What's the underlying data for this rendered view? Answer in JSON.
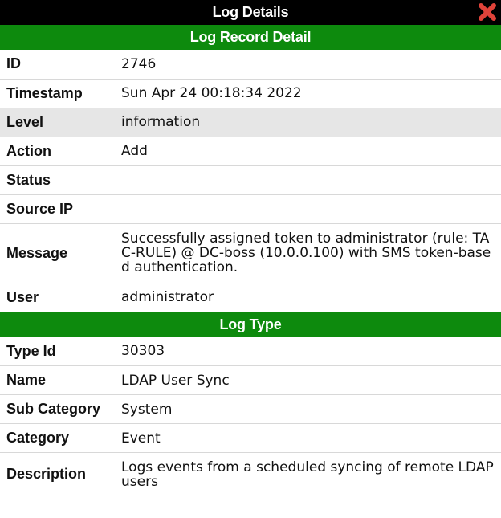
{
  "dialog": {
    "title": "Log Details"
  },
  "record": {
    "header": "Log Record Detail",
    "rows": [
      {
        "label": "ID",
        "value": "2746"
      },
      {
        "label": "Timestamp",
        "value": "Sun Apr 24 00:18:34 2022"
      },
      {
        "label": "Level",
        "value": "information"
      },
      {
        "label": "Action",
        "value": "Add"
      },
      {
        "label": "Status",
        "value": ""
      },
      {
        "label": "Source IP",
        "value": ""
      },
      {
        "label": "Message",
        "value": "Successfully assigned token to administrator (rule: TAC-RULE) @ DC-boss (10.0.0.100) with SMS token-based authentication."
      },
      {
        "label": "User",
        "value": "administrator"
      }
    ]
  },
  "logtype": {
    "header": "Log Type",
    "rows": [
      {
        "label": "Type Id",
        "value": "30303"
      },
      {
        "label": "Name",
        "value": "LDAP User Sync"
      },
      {
        "label": "Sub Category",
        "value": "System"
      },
      {
        "label": "Category",
        "value": "Event"
      },
      {
        "label": "Description",
        "value": "Logs events from a scheduled syncing of remote LDAP users"
      }
    ]
  },
  "icons": {
    "close": "close-icon",
    "close_color": "#e0433a"
  },
  "colors": {
    "title_bg": "#000000",
    "section_bg": "#0d8a0d",
    "highlight_row": "#e6e6e6"
  }
}
